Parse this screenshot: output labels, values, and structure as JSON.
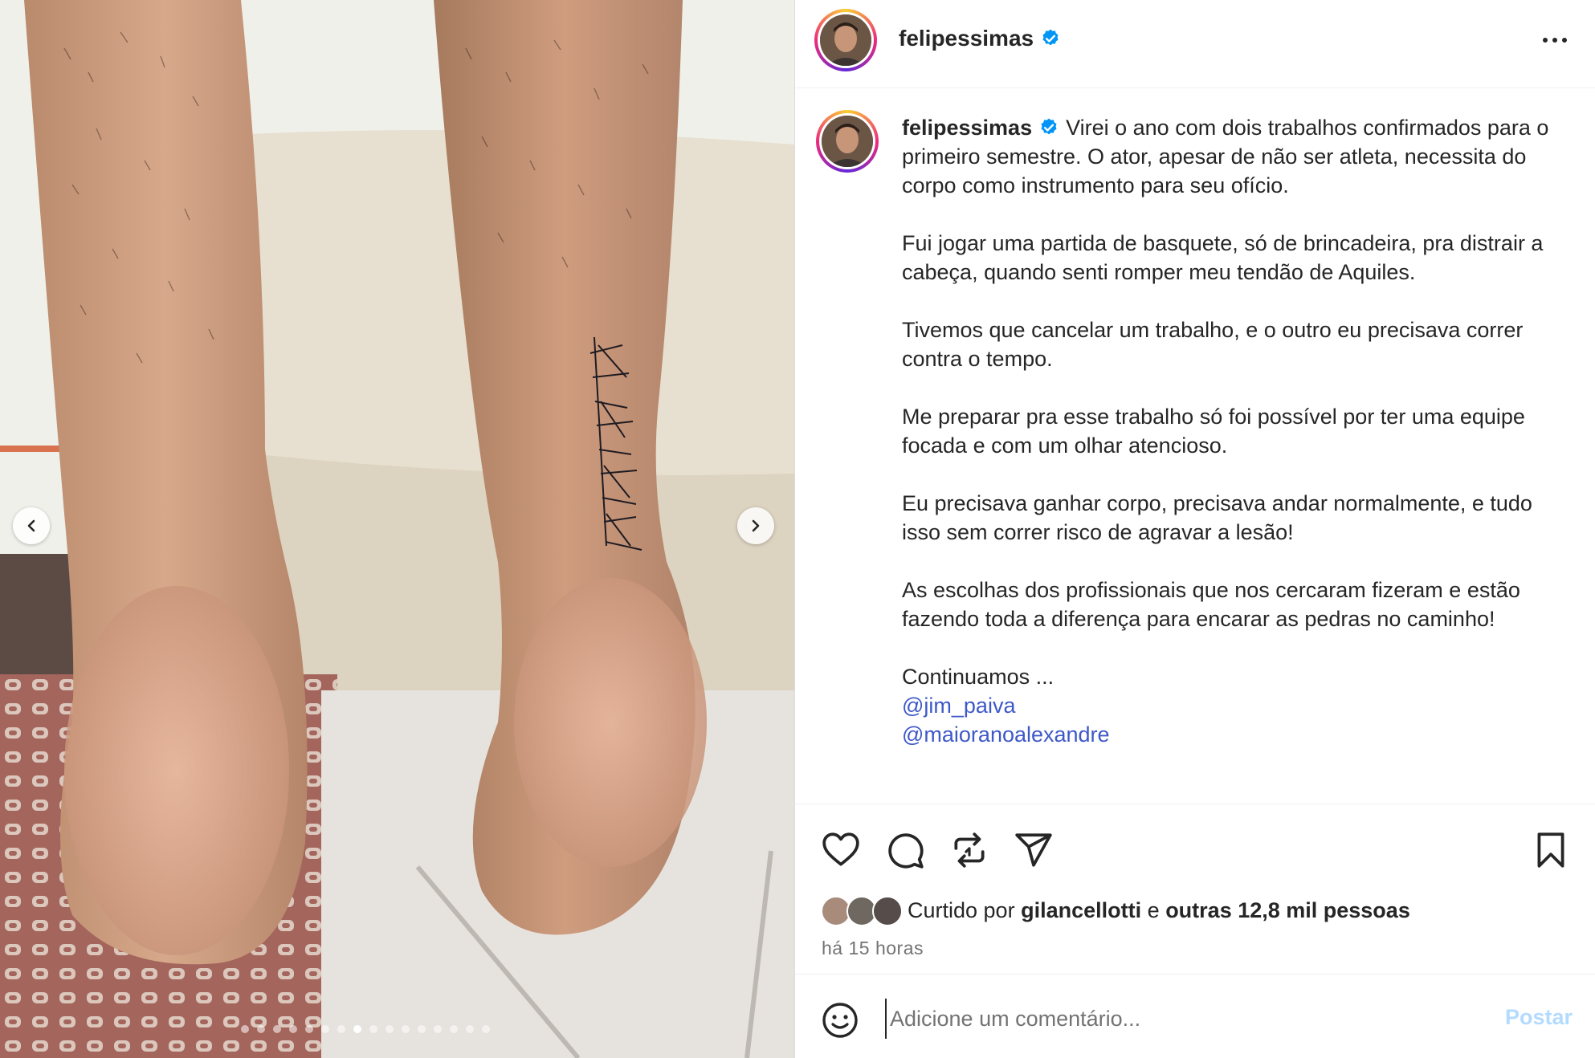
{
  "post": {
    "username": "felipessimas",
    "verified": true,
    "caption": {
      "p1": "Virei o ano com dois trabalhos confirmados para o primeiro semestre. O ator, apesar de não ser atleta, necessita do corpo como instrumento para seu ofício.",
      "p2": "Fui jogar uma partida de basquete, só de brincadeira, pra distrair a cabeça, quando senti romper meu tendão de Aquiles.",
      "p3": "Tivemos que cancelar um trabalho, e o outro eu precisava correr contra o tempo.",
      "p4": "Me preparar pra esse trabalho só foi possível por ter uma equipe focada e com um olhar atencioso.",
      "p5": "Eu precisava ganhar corpo, precisava andar normalmente, e tudo isso sem correr risco de agravar a lesão!",
      "p6": "As escolhas dos profissionais que nos cercaram fizeram e estão fazendo toda a diferença para encarar as pedras no caminho!",
      "p7": "Continuamos ...",
      "mentions": [
        "@jim_paiva",
        "@maioranoalexandre"
      ]
    },
    "likes": {
      "prefix": "Curtido por",
      "user": "gilancellotti",
      "connector": "e",
      "others": "outras 12,8 mil pessoas"
    },
    "timestamp": "há 15 horas",
    "comment": {
      "placeholder": "Adicione um comentário...",
      "post_label": "Postar"
    }
  },
  "media": {
    "carousel_count": 16,
    "active_index": 7
  },
  "icons": {
    "like": "heart-icon",
    "comment": "comment-icon",
    "repost": "repost-icon",
    "share": "share-icon",
    "save": "bookmark-icon",
    "more": "more-icon",
    "emoji": "emoji-icon"
  },
  "colors": {
    "link": "#3e58c9",
    "verified": "#0095f6",
    "post_disabled": "#b3dbff",
    "muted": "#737373"
  }
}
